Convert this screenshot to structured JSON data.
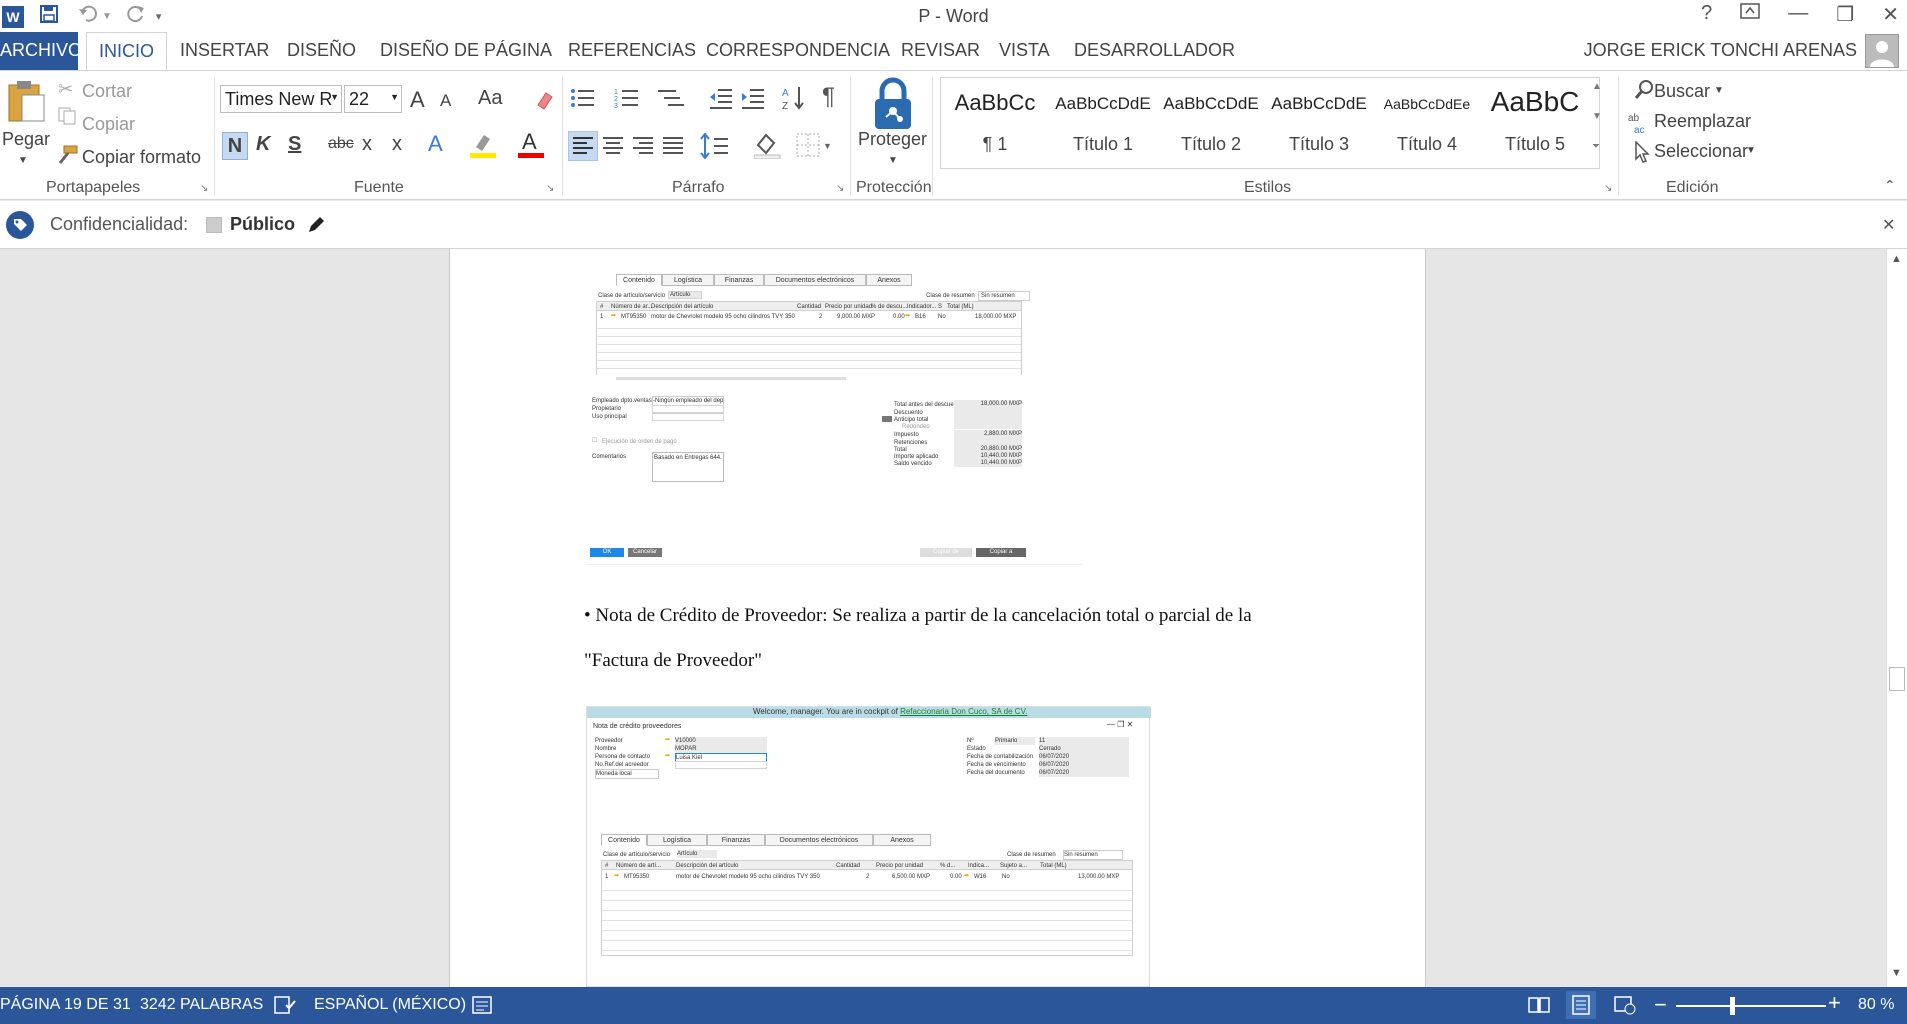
{
  "window": {
    "title": "P - Word",
    "controls": [
      "?",
      "⧉",
      "—",
      "❐",
      "✕"
    ]
  },
  "quick_access": [
    "word-logo",
    "save-icon",
    "undo-icon",
    "redo-icon",
    "customize-icon"
  ],
  "tabs": [
    {
      "label": "ARCHIVO"
    },
    {
      "label": "INICIO"
    },
    {
      "label": "INSERTAR"
    },
    {
      "label": "DISEÑO"
    },
    {
      "label": "DISEÑO DE PÁGINA"
    },
    {
      "label": "REFERENCIAS"
    },
    {
      "label": "CORRESPONDENCIA"
    },
    {
      "label": "REVISAR"
    },
    {
      "label": "VISTA"
    },
    {
      "label": "DESARROLLADOR"
    }
  ],
  "user": "JORGE ERICK TONCHI ARENAS",
  "ribbon": {
    "clipboard": {
      "paste": "Pegar",
      "cut": "Cortar",
      "copy": "Copiar",
      "format_painter": "Copiar formato",
      "label": "Portapapeles"
    },
    "font": {
      "name": "Times New R",
      "size": "22",
      "grow": "A",
      "shrink": "A",
      "change_case": "Aa",
      "bold": "N",
      "italic": "K",
      "underline": "S",
      "strike": "abc",
      "subscript": "x",
      "superscript": "x",
      "label": "Fuente"
    },
    "paragraph": {
      "label": "Párrafo"
    },
    "protection": {
      "protect": "Proteger",
      "label": "Protección"
    },
    "styles": {
      "label": "Estilos",
      "items": [
        {
          "preview": "AaBbCc",
          "name": "¶ 1"
        },
        {
          "preview": "AaBbCcDdE",
          "name": "Título 1"
        },
        {
          "preview": "AaBbCcDdE",
          "name": "Título 2"
        },
        {
          "preview": "AaBbCcDdE",
          "name": "Título 3"
        },
        {
          "preview": "AaBbCcDdEe",
          "name": "Título 4"
        },
        {
          "preview": "AaBbC",
          "name": "Título 5"
        }
      ]
    },
    "editing": {
      "find": "Buscar",
      "replace": "Reemplazar",
      "select": "Seleccionar",
      "label": "Edición"
    }
  },
  "infobar": {
    "label": "Confidencialidad:",
    "value": "Público"
  },
  "document": {
    "paragraph_line1": "• Nota de Crédito de Proveedor: Se realiza a partir de la cancelación total o parcial de la",
    "paragraph_line2": "\"Factura de Proveedor\"",
    "shot1": {
      "tabs": [
        "Contenido",
        "Logística",
        "Finanzas",
        "Documentos electrónicos",
        "Anexos"
      ],
      "class_label": "Clase de artículo/servicio",
      "class_value": "Artículo",
      "summary_label": "Clase de resumen",
      "summary_value": "Sin resumen",
      "columns": [
        "#",
        "Número de ar...",
        "Descripción del artículo",
        "Cantidad",
        "Precio por unidad",
        "% de descu...",
        "Indicador...",
        "S",
        "Total (ML)"
      ],
      "row": [
        "1",
        "MT95350",
        "motor de Chevrolet modelo 95 ocho cilindros TVY 350",
        "2",
        "9,000.00 MXP",
        "0.00",
        "B16",
        "No",
        "18,000.00 MXP"
      ],
      "left_labels": [
        "Empleado dpto.ventas",
        "Propietario",
        "Uso principal"
      ],
      "employee_value": "-Ningún empleado del depart",
      "payment_order": "Ejecución de orden de pago",
      "comments_label": "Comentarios",
      "comments_value": "Basado en Entregas 644.",
      "totals_labels": [
        "Total antes del descuento",
        "Descuento",
        "Anticipo total",
        "Redondeo",
        "Impuesto",
        "Retenciones",
        "Total",
        "Importe aplicado",
        "Saldo vencido"
      ],
      "totals_values": [
        "18,000.00 MXP",
        "",
        "",
        "",
        "2,880.00 MXP",
        "",
        "20,880.00 MXP",
        "10,440.00 MXP",
        "10,440.00 MXP"
      ],
      "ok": "OK",
      "cancel": "Cancelar",
      "copy_from": "Copiar de",
      "copy_to": "Copiar a"
    },
    "shot2": {
      "welcome": "Welcome, manager. You are in cockpit of",
      "company": "Refaccionaria Don Cuco, SA de CV.",
      "window_title": "Nota de crédito proveedores",
      "left_labels": [
        "Proveedor",
        "Nombre",
        "Persona de contacto",
        "No.Ref.del acreedor",
        "Moneda local"
      ],
      "left_values": [
        "V10000",
        "MOPAR",
        "Luisa Kiel",
        "",
        ""
      ],
      "right_labels": [
        "Nº",
        "Estado",
        "Fecha de contabilización",
        "Fecha de vencimiento",
        "Fecha del documento"
      ],
      "right_values": [
        "11",
        "Cerrado",
        "06/07/2020",
        "06/07/2020",
        "06/07/2020"
      ],
      "series": "Primario",
      "tabs": [
        "Contenido",
        "Logística",
        "Finanzas",
        "Documentos electrónicos",
        "Anexos"
      ],
      "class_label": "Clase de artículo/servicio",
      "class_value": "Artículo",
      "summary_label": "Clase de resumen",
      "summary_value": "Sin resumen",
      "columns": [
        "#",
        "Número de artí...",
        "Descripción del artículo",
        "Cantidad",
        "Precio por unidad",
        "% d...",
        "Indica...",
        "Sujeto a...",
        "Total (ML)"
      ],
      "row": [
        "1",
        "MT95350",
        "motor de Chevrolet modelo 95 ocho cilindros TVY 350",
        "2",
        "6,500.00 MXP",
        "0.00",
        "W16",
        "No",
        "13,000.00 MXP"
      ]
    }
  },
  "status": {
    "page": "PÁGINA 19 DE 31",
    "words": "3242 PALABRAS",
    "language": "ESPAÑOL (MÉXICO)",
    "zoom": "80 %",
    "zoom_level": 0.8
  },
  "colors": {
    "accent": "#2b579a",
    "sap_blue": "#1e88e5",
    "welcome_bar": "#b9dde6"
  }
}
